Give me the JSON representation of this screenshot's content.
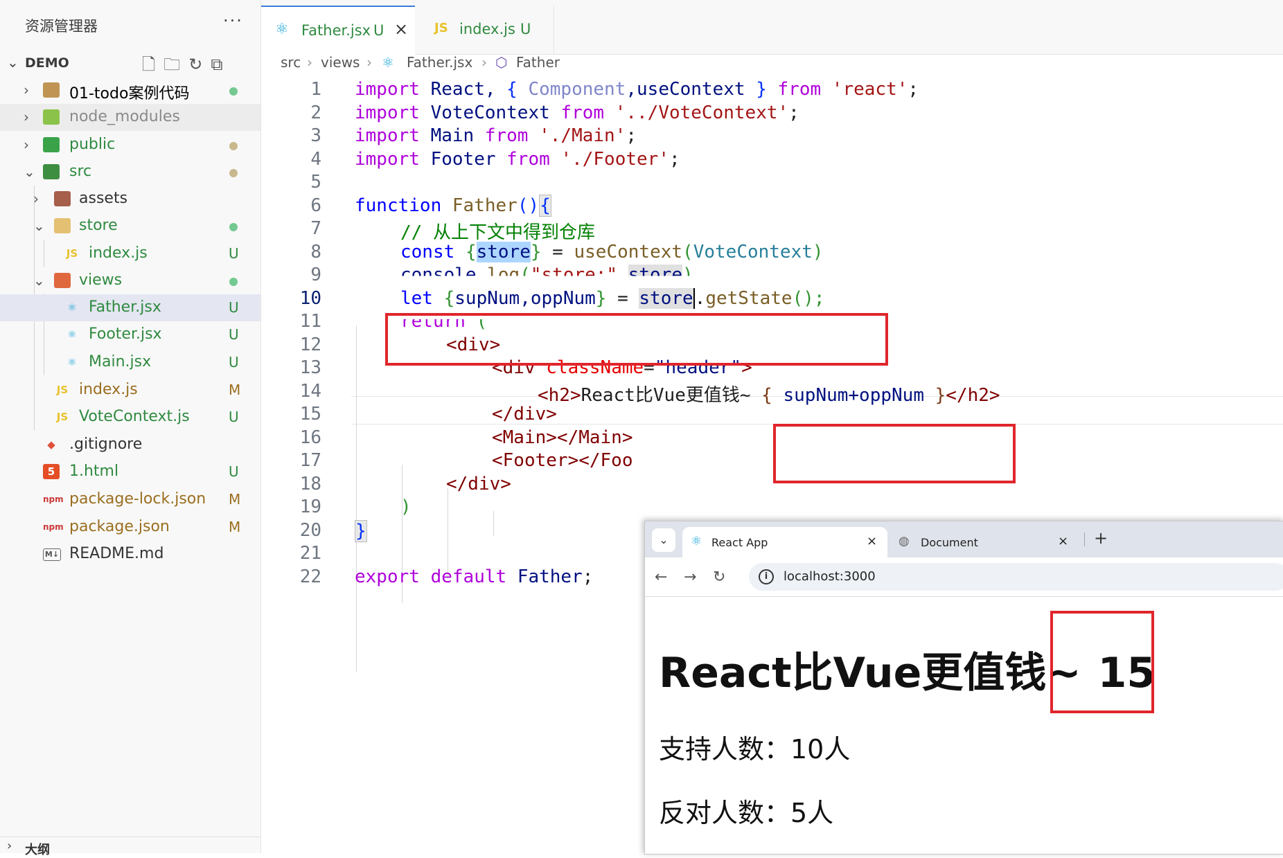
{
  "explorer": {
    "title": "资源管理器",
    "more": "···",
    "project": "DEMO",
    "items": [
      {
        "label": "01-todo案例代码",
        "badge": ""
      },
      {
        "label": "node_modules",
        "badge": ""
      },
      {
        "label": "public",
        "badge": ""
      },
      {
        "label": "src",
        "badge": ""
      },
      {
        "label": "assets",
        "badge": ""
      },
      {
        "label": "store",
        "badge": ""
      },
      {
        "label": "index.js",
        "badge": "U"
      },
      {
        "label": "views",
        "badge": ""
      },
      {
        "label": "Father.jsx",
        "badge": "U"
      },
      {
        "label": "Footer.jsx",
        "badge": "U"
      },
      {
        "label": "Main.jsx",
        "badge": "U"
      },
      {
        "label": "index.js",
        "badge": "M"
      },
      {
        "label": "VoteContext.js",
        "badge": "U"
      },
      {
        "label": ".gitignore",
        "badge": ""
      },
      {
        "label": "1.html",
        "badge": "U"
      },
      {
        "label": "package-lock.json",
        "badge": "M"
      },
      {
        "label": "package.json",
        "badge": "M"
      },
      {
        "label": "README.md",
        "badge": ""
      }
    ],
    "outline": "大纲",
    "icons": {
      "js": "JS",
      "html": "5",
      "npm": "npm",
      "md": "M↓"
    }
  },
  "editor": {
    "tabs": [
      {
        "label": "Father.jsx",
        "status": "U",
        "icon": "react-icon"
      },
      {
        "label": "index.js",
        "status": "U",
        "icon": "JS"
      }
    ],
    "breadcrumb": [
      "src",
      "views",
      "Father.jsx",
      "Father"
    ],
    "line_numbers": [
      "1",
      "2",
      "3",
      "4",
      "5",
      "6",
      "7",
      "8",
      "9",
      "10",
      "11",
      "12",
      "13",
      "14",
      "15",
      "16",
      "17",
      "18",
      "19",
      "20",
      "21",
      "22"
    ],
    "current_line": "10",
    "code": {
      "l1": [
        "import",
        " React, ",
        "{",
        " ",
        "Component",
        ",useContext ",
        "}",
        " ",
        "from",
        " ",
        "'react'",
        ";"
      ],
      "l2": [
        "import",
        " VoteContext ",
        "from",
        " ",
        "'../VoteContext'",
        ";"
      ],
      "l3": [
        "import",
        " Main ",
        "from",
        " ",
        "'./Main'",
        ";"
      ],
      "l4": [
        "import",
        " Footer ",
        "from",
        " ",
        "'./Footer'",
        ";"
      ],
      "l6": [
        "function",
        " ",
        "Father",
        "()",
        "{"
      ],
      "l7": "// 从上下文中得到仓库",
      "l8": [
        "const",
        " ",
        "{",
        "store",
        "}",
        " = ",
        "useContext",
        "(",
        "VoteContext",
        ")"
      ],
      "l9": [
        "console",
        ".",
        "log",
        "(",
        "\"store:\"",
        ",",
        "store",
        ")"
      ],
      "l10": [
        "let",
        " ",
        "{",
        "supNum,oppNum",
        "}",
        " = ",
        "store",
        ".",
        "getState",
        "();"
      ],
      "l11": [
        "return",
        " ",
        "("
      ],
      "l12": [
        "<div>"
      ],
      "l13": [
        "<div",
        " ",
        "className",
        "=",
        "\"header\"",
        ">"
      ],
      "l14": [
        "<h2>",
        "React比Vue更值钱~ ",
        "{",
        " supNum+oppNum ",
        "}",
        "</h2>"
      ],
      "l15": [
        "</div>"
      ],
      "l16": [
        "<Main></Main>"
      ],
      "l17": [
        "<Footer></Foo"
      ],
      "l18": [
        "</div>"
      ],
      "l19": [
        ")"
      ],
      "l20": [
        "}"
      ],
      "l22": [
        "export",
        " ",
        "default",
        " ",
        "Father",
        ";"
      ]
    }
  },
  "browser": {
    "tabs": [
      {
        "label": "React App",
        "icon": "react-icon"
      },
      {
        "label": "Document",
        "icon": "globe-icon"
      }
    ],
    "new_tab": "+",
    "url": "localhost:3000",
    "heading_text": "React比Vue更值钱~",
    "heading_value": "15",
    "support_line": "支持人数：10人",
    "oppose_line": "反对人数：5人"
  },
  "colors": {
    "annotation_red": "#e0262c",
    "accent": "#3b7bd6"
  }
}
